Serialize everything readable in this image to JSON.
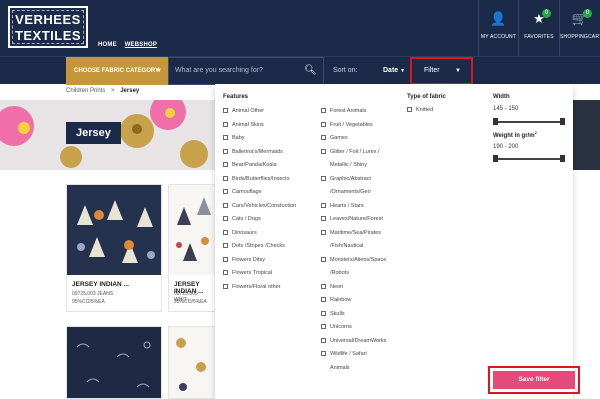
{
  "brand": {
    "logo_line1": "VERHEES",
    "logo_line2": "TEXTILES"
  },
  "topnav": {
    "home": "HOME",
    "webshop": "WEBSHOP"
  },
  "header_icons": {
    "account": {
      "label": "MY ACCOUNT",
      "icon": "user-icon"
    },
    "favorites": {
      "label": "FAVORITES",
      "icon": "star-icon",
      "count": "0"
    },
    "cart": {
      "label": "SHOPPINGCART",
      "icon": "cart-icon",
      "count": "0"
    }
  },
  "search": {
    "category_label": "CHOOSE FABRIC CATEGORY",
    "placeholder": "What are you searching for?",
    "sort_label": "Sort on:",
    "sort_value": "Date",
    "filter_label": "Filter"
  },
  "breadcrumb": {
    "parent": "Children Prints",
    "sep": ">",
    "current": "Jersey"
  },
  "hero": {
    "title": "Jersey"
  },
  "products": [
    {
      "title": "JERSEY INDIAN ...",
      "code": "09725.003 JEANS",
      "comp": "95%CO/5%EA"
    },
    {
      "title": "JERSEY INDIAN ...",
      "code": "09725.005 WHIT...",
      "comp": "95%CO/5%EA"
    }
  ],
  "filter_panel": {
    "features_heading": "Features",
    "features_col1": [
      "Animal Other",
      "Animal Skins",
      "Baby",
      "Ballerina's/Mermaids",
      "Bear/Panda/Koala",
      "Birds/Butterflies/Insects",
      "Camouflage",
      "Cars/Vehicles/Constuction",
      "Cats / Dogs",
      "Dinosaurs",
      "Dots /Stripes /Checks",
      "Flowers Ditsy",
      "Flowers Tropical",
      "Flowers/Floral other"
    ],
    "features_col2": [
      {
        "line1": "Forest Animals"
      },
      {
        "line1": "Fruit / Vegetables"
      },
      {
        "line1": "Games"
      },
      {
        "line1": "Glitter / Foil / Lurex /",
        "line2": "Metallic / Shiny"
      },
      {
        "line1": "Graphic/Abstract",
        "line2": "/Ornaments/Geo"
      },
      {
        "line1": "Hearts / Stars"
      },
      {
        "line1": "Leaves/Nature/Forest"
      },
      {
        "line1": "Maritime/Sea/Pirates",
        "line2": "/Fish/Nautical"
      },
      {
        "line1": "Monsters/Aliens/Space",
        "line2": "/Robots"
      },
      {
        "line1": "Neon"
      },
      {
        "line1": "Rainbow"
      },
      {
        "line1": "Skulls"
      },
      {
        "line1": "Unicorns"
      },
      {
        "line1": "Universal/DreamWorks"
      },
      {
        "line1": "Wildlife / Safari",
        "line2": "Animals"
      }
    ],
    "fabric_heading": "Type of fabric",
    "fabric_options": [
      "Knitted"
    ],
    "width_heading": "Width",
    "width_range": "145 - 150",
    "width_min": 145,
    "width_max": 150,
    "weight_heading": "Weight in gr/m",
    "weight_sup": "2",
    "weight_range": "190 - 200",
    "weight_min": 190,
    "weight_max": 200,
    "save_label": "Save filter"
  },
  "colors": {
    "navy": "#1c2a4a",
    "gold": "#c5973a",
    "save_pink": "#e54b7a",
    "highlight_red": "#e0151b",
    "badge_green": "#29a745"
  }
}
